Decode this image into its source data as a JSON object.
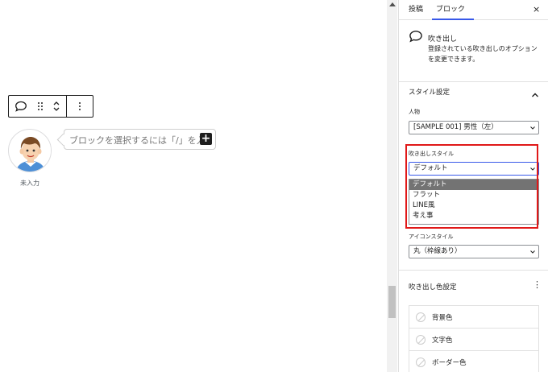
{
  "canvas": {
    "bubble_placeholder": "ブロックを選択するには「/」を入力",
    "avatar_caption": "未入力",
    "inserter_icon": "plus-icon"
  },
  "sidebar": {
    "tabs": [
      "投稿",
      "ブロック"
    ],
    "active_tab": "ブロック",
    "close_icon": "×",
    "block_card": {
      "title": "吹き出し",
      "description": "登録されている吹き出しのオプションを変更できます。"
    },
    "style_panel": {
      "title": "スタイル設定",
      "person_label": "人物",
      "person_value": "[SAMPLE 001] 男性（左）",
      "bubble_style_label": "吹き出しスタイル",
      "bubble_style_value": "デフォルト",
      "bubble_style_options": [
        "デフォルト",
        "フラット",
        "LINE風",
        "考え事"
      ],
      "icon_style_label": "アイコンスタイル",
      "icon_style_value": "丸（枠線あり）"
    },
    "color_panel": {
      "title": "吹き出し色設定",
      "menu_icon": "⋮",
      "items": [
        "背景色",
        "文字色",
        "ボーダー色"
      ]
    }
  },
  "colors": {
    "accent": "#3858e9",
    "highlight": "#e01818",
    "selected_option_bg": "#737373"
  }
}
